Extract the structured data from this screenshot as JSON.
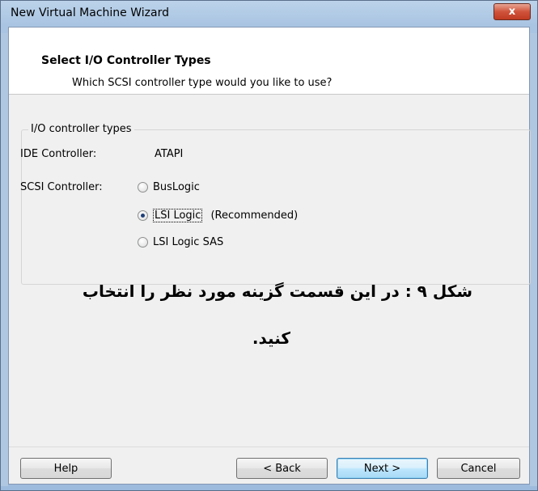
{
  "window": {
    "title": "New Virtual Machine Wizard",
    "close_glyph": "x"
  },
  "header": {
    "title": "Select I/O Controller Types",
    "subtitle": "Which SCSI controller type would you like to use?"
  },
  "group": {
    "legend": "I/O controller types",
    "ide_label": "IDE Controller:",
    "ide_value": "ATAPI",
    "scsi_label": "SCSI Controller:",
    "options": [
      {
        "label": "BusLogic",
        "checked": false
      },
      {
        "label": "LSI Logic",
        "suffix": "(Recommended)",
        "checked": true
      },
      {
        "label": "LSI Logic SAS",
        "checked": false
      }
    ]
  },
  "caption": {
    "line1": "شکل ۹ : در این قسمت گزینه مورد نظر را انتخاب",
    "line2": "کنید."
  },
  "buttons": {
    "help": "Help",
    "back": "< Back",
    "next": "Next >",
    "cancel": "Cancel"
  }
}
